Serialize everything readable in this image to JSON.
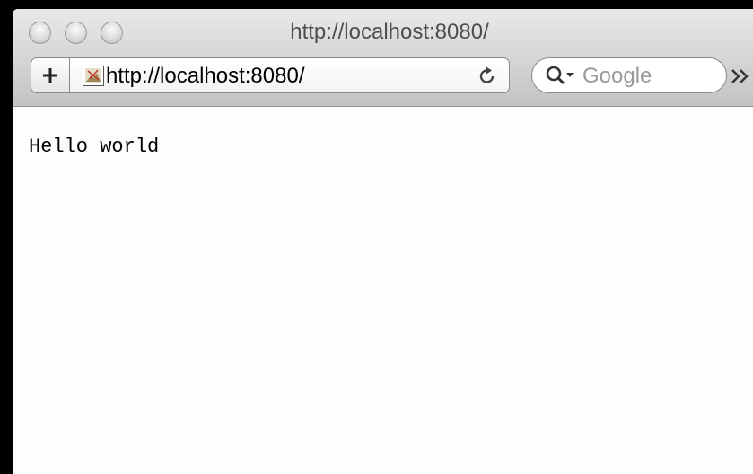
{
  "window": {
    "title": "http://localhost:8080/"
  },
  "toolbar": {
    "add_bookmark_label": "+",
    "address_url": "http://localhost:8080/",
    "search_placeholder": "Google",
    "overflow_label": "»"
  },
  "page": {
    "body_text": "Hello world"
  },
  "icons": {
    "traffic_lights": [
      "close-button",
      "minimize-button",
      "zoom-button"
    ],
    "favicon": "broken-image-icon",
    "reload": "reload-icon",
    "search": "search-icon",
    "overflow": "chevron-double-right-icon"
  },
  "colors": {
    "chrome_top": "#e9e9e9",
    "chrome_bottom": "#c3c3c3",
    "content_background": "#fdfdfd",
    "outer_background": "#000000"
  }
}
